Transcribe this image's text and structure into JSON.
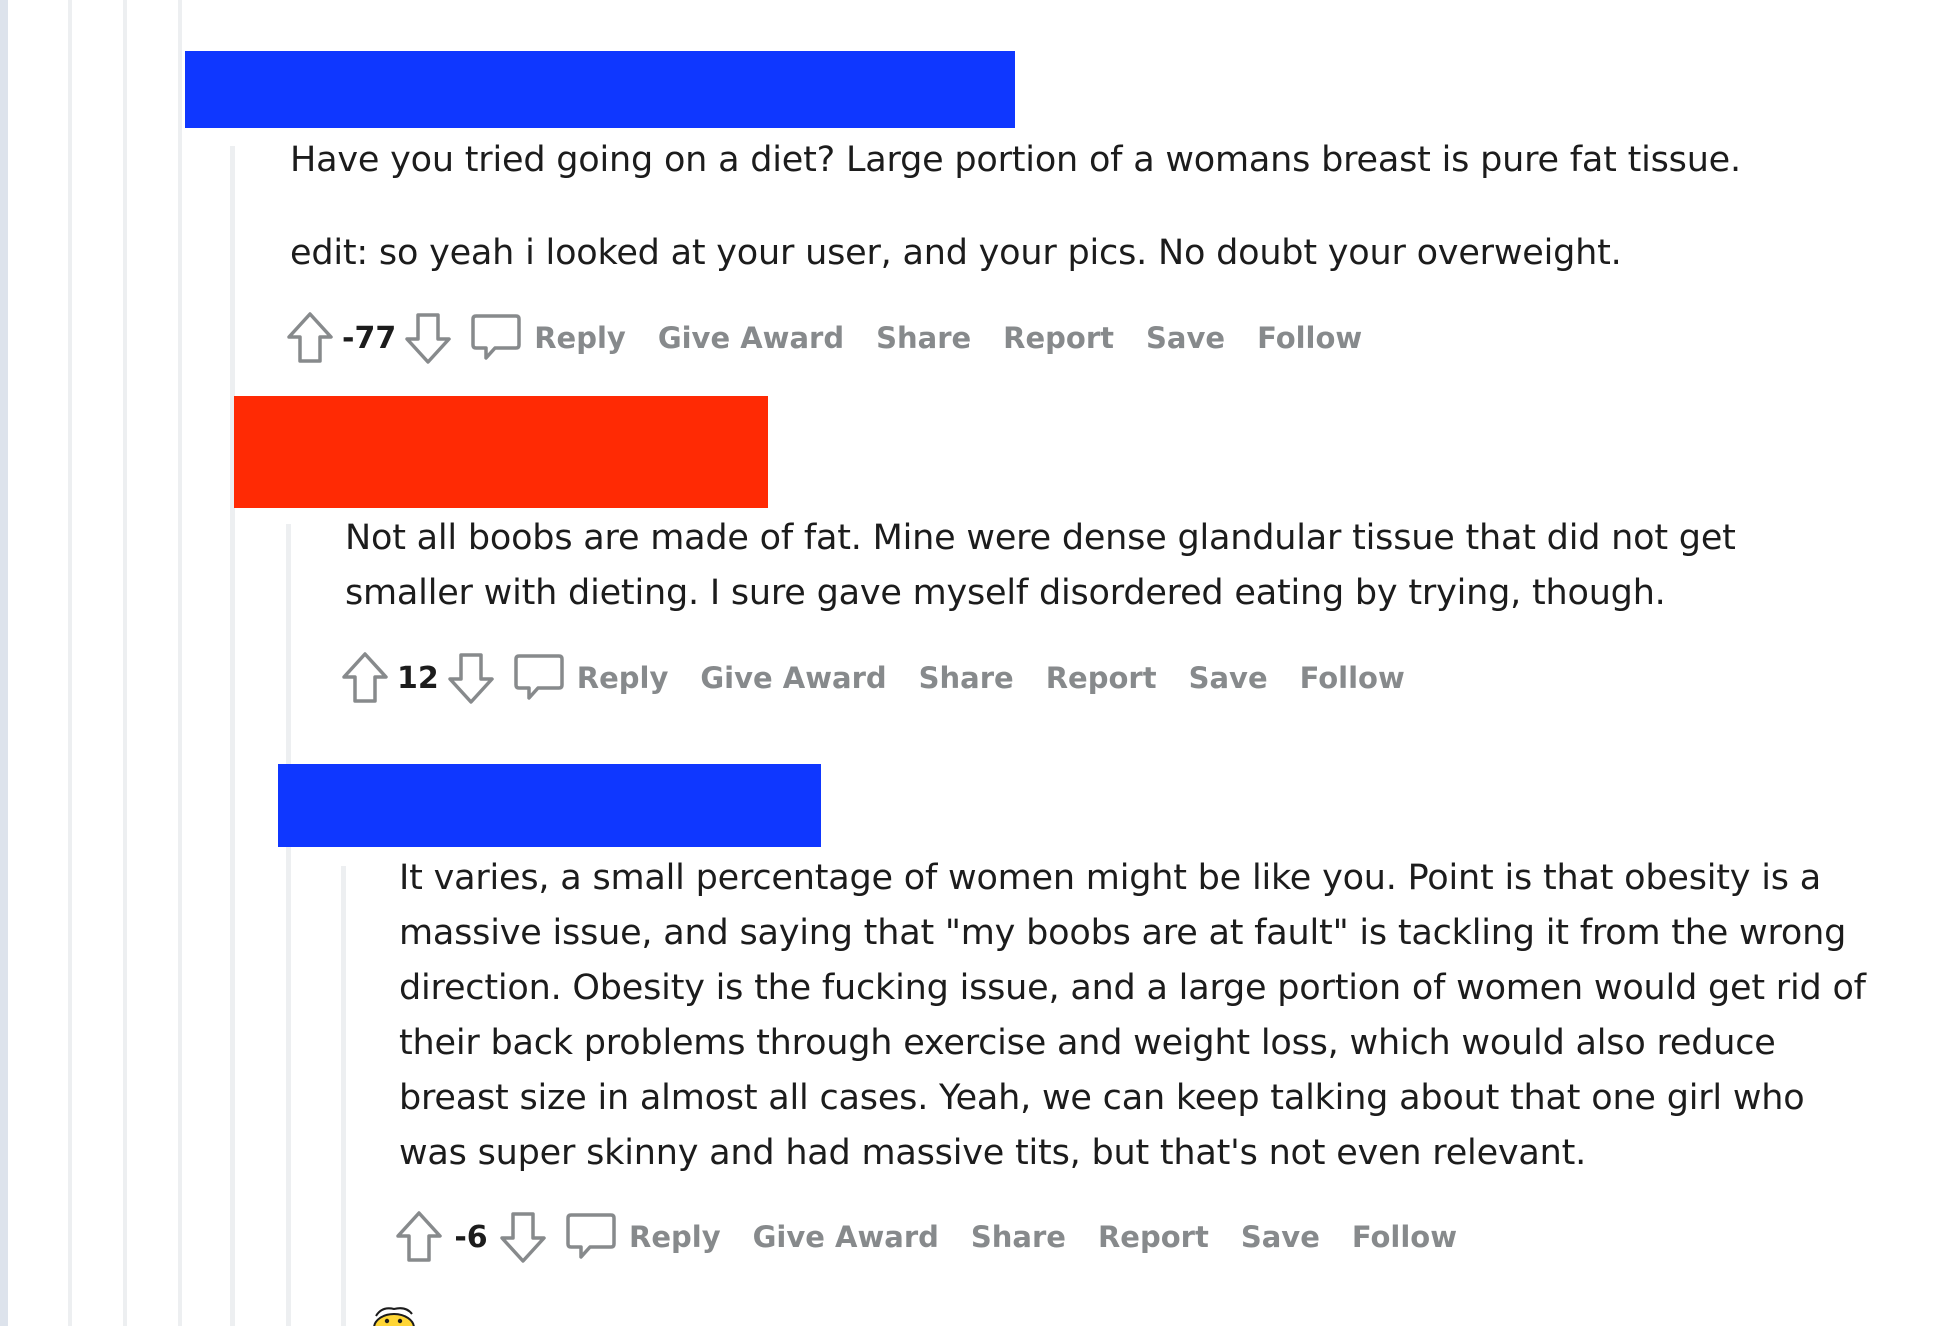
{
  "colors": {
    "redact_blue": "#0f37ff",
    "redact_red": "#ff2a04",
    "text": "#1c1c1c",
    "muted": "#878a8c",
    "thread_line": "#edeff1"
  },
  "icons": {
    "upvote": "arrow-up-outline-icon",
    "downvote": "arrow-down-outline-icon",
    "reply": "speech-bubble-icon",
    "avatar": "snoo-avatar-icon"
  },
  "comments": [
    {
      "paragraphs": [
        "Have you tried going on a diet? Large portion of a womans breast is pure fat tissue.",
        "edit: so yeah i looked at your user, and your pics. No doubt your overweight."
      ],
      "score": "-77"
    },
    {
      "lines": [
        "Not all boobs are made of fat. Mine were dense glandular tissue that did not get",
        "smaller with dieting. I sure gave myself disordered eating by trying, though."
      ],
      "score": "12"
    },
    {
      "lines": [
        "It varies, a small percentage of women might be like you. Point is that obesity is a",
        "massive issue, and saying that \"my boobs are at fault\" is tackling it from the wrong",
        "direction. Obesity is the fucking issue, and a large portion of women would get rid of",
        "their back problems through exercise and weight loss, which would also reduce",
        "breast size in almost all cases. Yeah, we can keep talking about that one girl who",
        "was super skinny and had massive tits, but that's not even relevant."
      ],
      "score": "-6"
    }
  ],
  "actions": {
    "reply": "Reply",
    "give_award": "Give Award",
    "share": "Share",
    "report": "Report",
    "save": "Save",
    "follow": "Follow"
  }
}
